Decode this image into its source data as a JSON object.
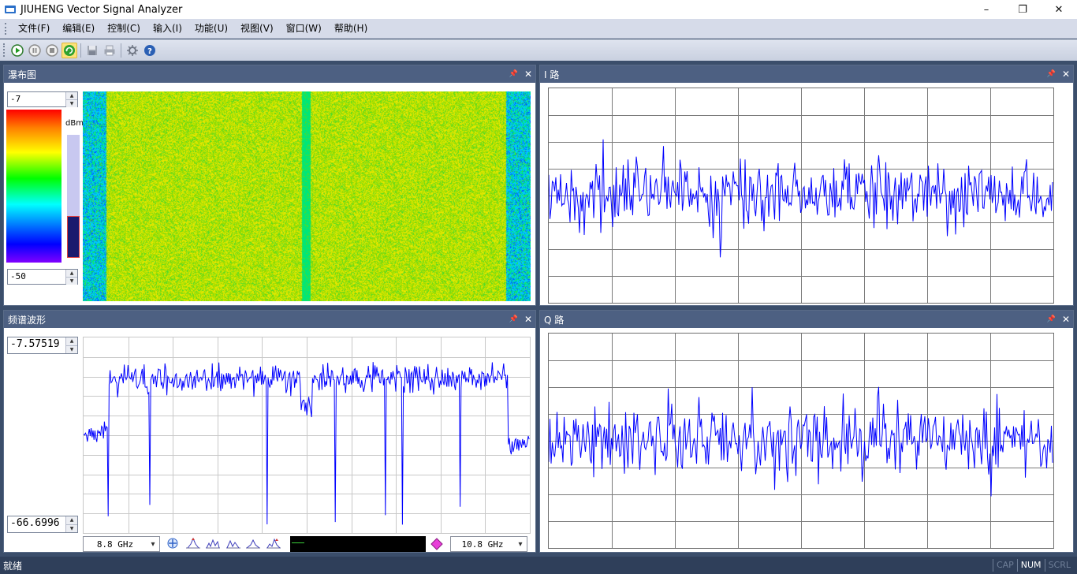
{
  "window": {
    "title": "JIUHENG Vector Signal Analyzer",
    "controls": [
      "–",
      "❐",
      "✕"
    ]
  },
  "menu": [
    "文件(F)",
    "编辑(E)",
    "控制(C)",
    "输入(I)",
    "功能(U)",
    "视图(V)",
    "窗口(W)",
    "帮助(H)"
  ],
  "toolbar": {
    "buttons": [
      "play-icon",
      "pause-icon",
      "stop-icon",
      "refresh-icon",
      "save-icon",
      "print-icon",
      "settings-icon",
      "help-icon"
    ],
    "active_button": "refresh-icon"
  },
  "panels": {
    "waterfall": {
      "title": "瀑布图",
      "pin": "📌",
      "close": "✕",
      "max_value": "-7",
      "min_value": "-50",
      "unit_label": "dBm",
      "level_fraction": 0.34
    },
    "i_channel": {
      "title": "I 路",
      "pin": "📌",
      "close": "✕"
    },
    "spectrum": {
      "title": "频谱波形",
      "pin": "📌",
      "close": "✕",
      "max_value": "-7.57519",
      "min_value": "-66.6996",
      "start_freq": "8.8 GHz",
      "stop_freq": "10.8 GHz"
    },
    "q_channel": {
      "title": "Q 路",
      "pin": "📌",
      "close": "✕"
    }
  },
  "colors": {
    "trace": "#0000ff",
    "grid": "#7a7a7a",
    "panel_header": "#4d6082",
    "desktop": "#3b4e6b"
  },
  "status": {
    "text": "就绪",
    "indicators": [
      {
        "label": "CAP",
        "active": false
      },
      {
        "label": "NUM",
        "active": true
      },
      {
        "label": "SCRL",
        "active": false
      }
    ]
  }
}
